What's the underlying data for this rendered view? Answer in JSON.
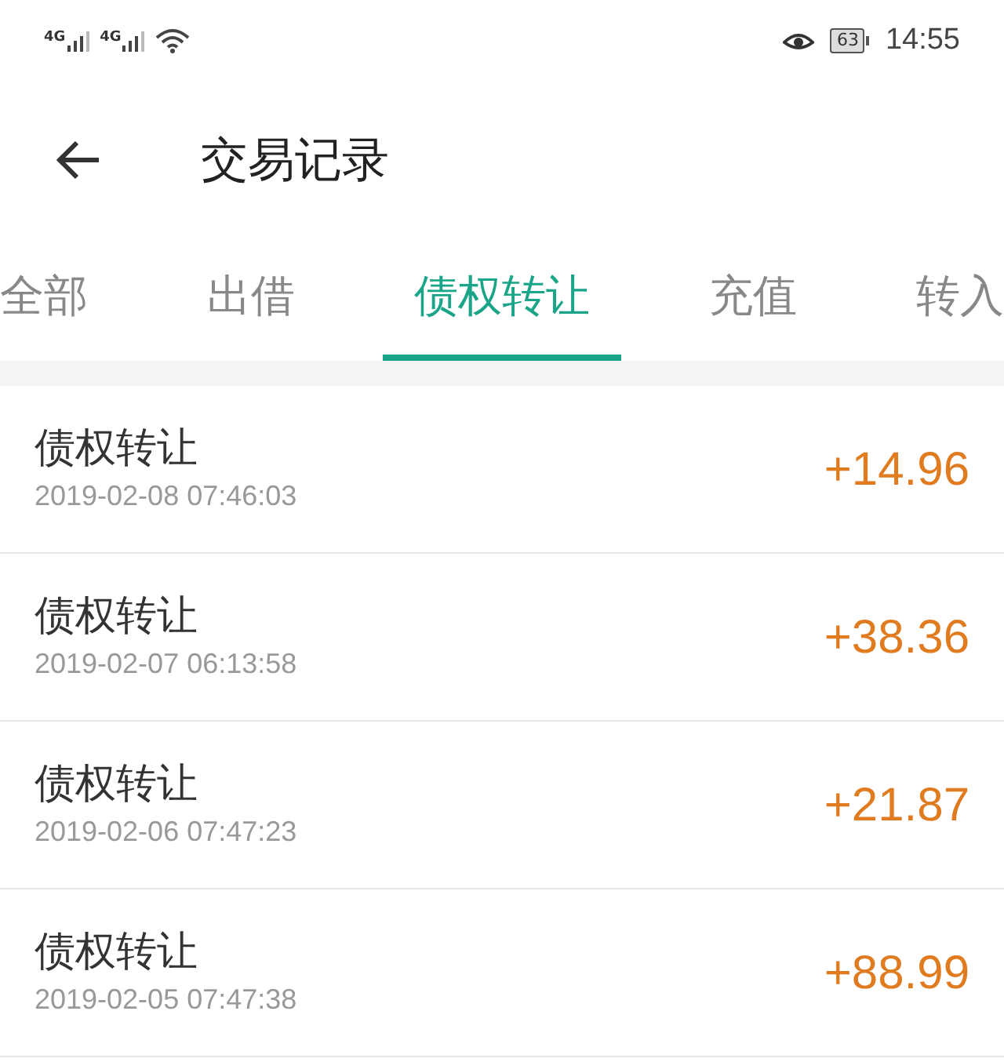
{
  "status_bar": {
    "signals": [
      "4G",
      "4G"
    ],
    "battery": "63",
    "time": "14:55"
  },
  "header": {
    "title": "交易记录"
  },
  "tabs": [
    {
      "label": "全部",
      "selected": false
    },
    {
      "label": "出借",
      "selected": false
    },
    {
      "label": "债权转让",
      "selected": true
    },
    {
      "label": "充值",
      "selected": false
    },
    {
      "label": "转入",
      "selected": false
    }
  ],
  "records": [
    {
      "title": "债权转让",
      "time": "2019-02-08 07:46:03",
      "amount": "+14.96"
    },
    {
      "title": "债权转让",
      "time": "2019-02-07 06:13:58",
      "amount": "+38.36"
    },
    {
      "title": "债权转让",
      "time": "2019-02-06 07:47:23",
      "amount": "+21.87"
    },
    {
      "title": "债权转让",
      "time": "2019-02-05 07:47:38",
      "amount": "+88.99"
    }
  ]
}
